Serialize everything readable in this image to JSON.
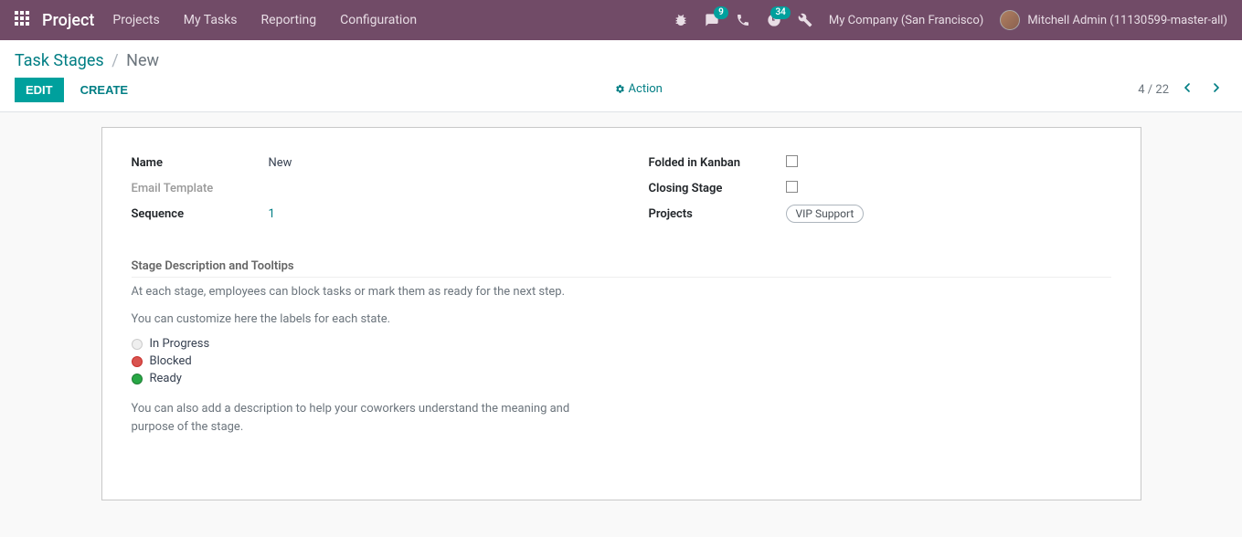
{
  "nav": {
    "brand": "Project",
    "menu": [
      "Projects",
      "My Tasks",
      "Reporting",
      "Configuration"
    ],
    "messages_badge": "9",
    "activities_badge": "34",
    "company": "My Company (San Francisco)",
    "user": "Mitchell Admin (11130599-master-all)"
  },
  "breadcrumb": {
    "parent": "Task Stages",
    "current": "New"
  },
  "buttons": {
    "edit": "EDIT",
    "create": "CREATE",
    "action": "Action"
  },
  "pager": {
    "value": "4 / 22"
  },
  "form": {
    "labels": {
      "name": "Name",
      "email_template": "Email Template",
      "sequence": "Sequence",
      "folded": "Folded in Kanban",
      "closing": "Closing Stage",
      "projects": "Projects"
    },
    "values": {
      "name": "New",
      "sequence": "1",
      "project_tag": "VIP Support"
    }
  },
  "section": {
    "title": "Stage Description and Tooltips",
    "intro1": "At each stage, employees can block tasks or mark them as ready for the next step.",
    "intro2": "You can customize here the labels for each state.",
    "states": {
      "in_progress": "In Progress",
      "blocked": "Blocked",
      "ready": "Ready"
    },
    "outro": "You can also add a description to help your coworkers understand the meaning and purpose of the stage."
  }
}
